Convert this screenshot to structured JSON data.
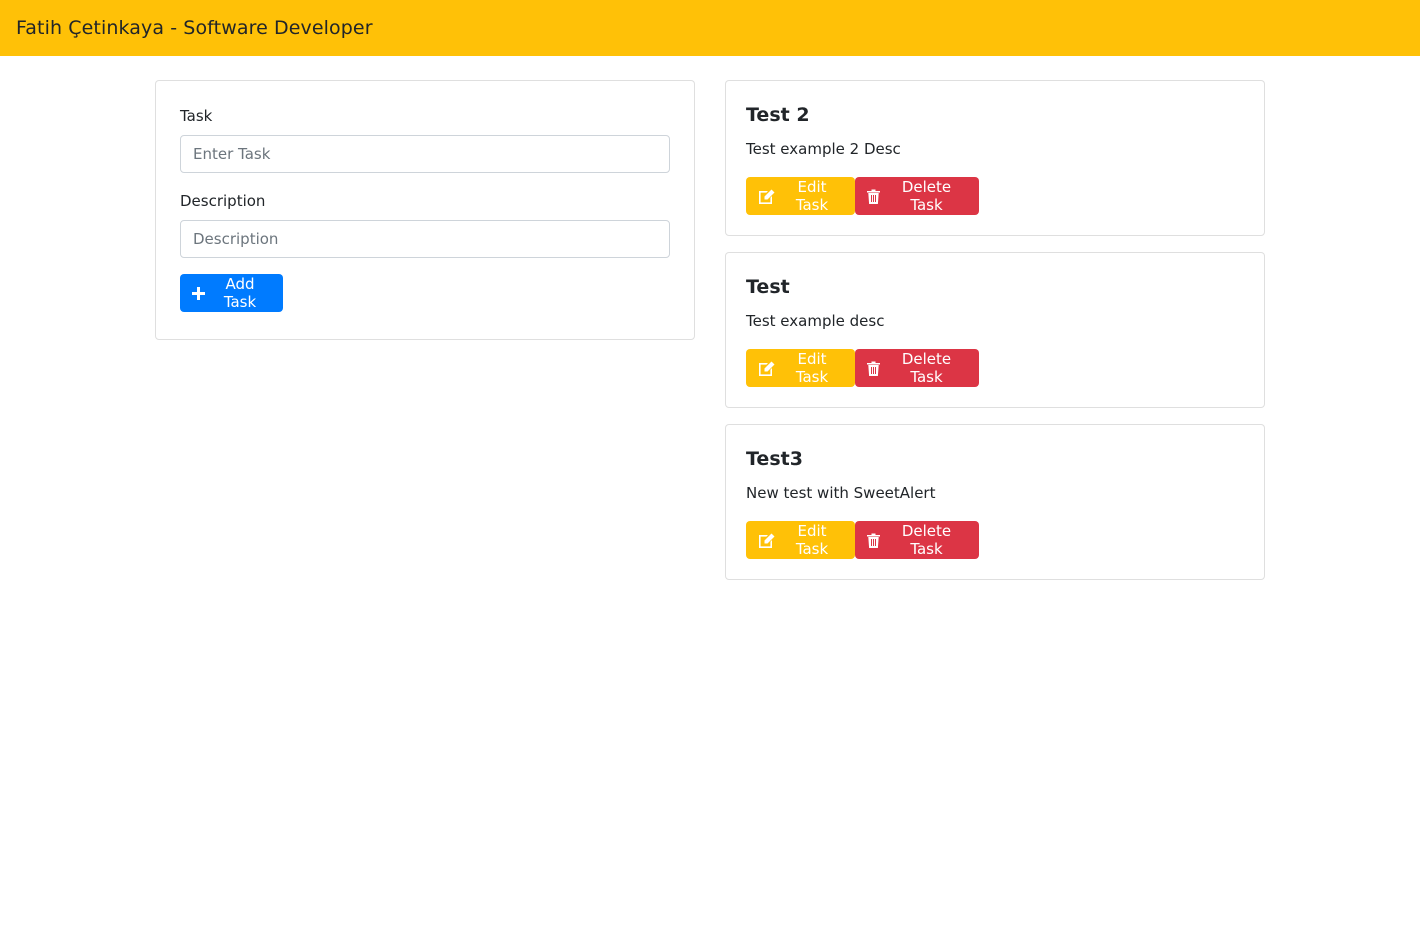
{
  "navbar": {
    "brand": "Fatih Çetinkaya - Software Developer"
  },
  "form": {
    "task_label": "Task",
    "task_placeholder": "Enter Task",
    "task_value": "",
    "description_label": "Description",
    "description_placeholder": "Description",
    "description_value": "",
    "add_button_label": "Add Task",
    "add_icon": "plus-icon"
  },
  "tasks": [
    {
      "title": "Test 2",
      "description": "Test example 2 Desc",
      "edit_label": "Edit Task",
      "delete_label": "Delete Task"
    },
    {
      "title": "Test",
      "description": "Test example desc",
      "edit_label": "Edit Task",
      "delete_label": "Delete Task"
    },
    {
      "title": "Test3",
      "description": "New test with SweetAlert",
      "edit_label": "Edit Task",
      "delete_label": "Delete Task"
    }
  ],
  "icons": {
    "edit": "edit-icon",
    "delete": "trash-icon"
  },
  "colors": {
    "navbar": "#ffc107",
    "primary": "#007bff",
    "warning": "#ffc107",
    "danger": "#dc3545"
  }
}
